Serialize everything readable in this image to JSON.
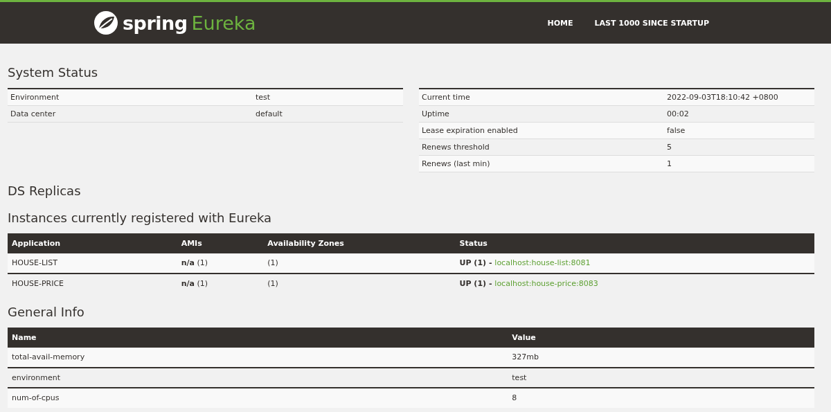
{
  "header": {
    "brand": "spring",
    "product": "Eureka",
    "nav": [
      {
        "label": "HOME"
      },
      {
        "label": "LAST 1000 SINCE STARTUP"
      }
    ]
  },
  "system_status": {
    "title": "System Status",
    "left": [
      {
        "name": "Environment",
        "value": "test"
      },
      {
        "name": "Data center",
        "value": "default"
      }
    ],
    "right": [
      {
        "name": "Current time",
        "value": "2022-09-03T18:10:42 +0800"
      },
      {
        "name": "Uptime",
        "value": "00:02"
      },
      {
        "name": "Lease expiration enabled",
        "value": "false"
      },
      {
        "name": "Renews threshold",
        "value": "5"
      },
      {
        "name": "Renews (last min)",
        "value": "1"
      }
    ]
  },
  "ds_replicas": {
    "title": "DS Replicas"
  },
  "instances": {
    "title": "Instances currently registered with Eureka",
    "columns": [
      "Application",
      "AMIs",
      "Availability Zones",
      "Status"
    ],
    "rows": [
      {
        "application": "HOUSE-LIST",
        "amis": "**n/a** (1)",
        "zones": "(1)",
        "status": "UP (1) -",
        "link": "localhost:house-list:8081"
      },
      {
        "application": "HOUSE-PRICE",
        "amis": "**n/a** (1)",
        "zones": "(1)",
        "status": "UP (1) -",
        "link": "localhost:house-price:8083"
      }
    ]
  },
  "general_info": {
    "title": "General Info",
    "columns": [
      "Name",
      "Value"
    ],
    "rows": [
      {
        "name": "total-avail-memory",
        "value": "327mb"
      },
      {
        "name": "environment",
        "value": "test"
      },
      {
        "name": "num-of-cpus",
        "value": "8"
      }
    ]
  }
}
